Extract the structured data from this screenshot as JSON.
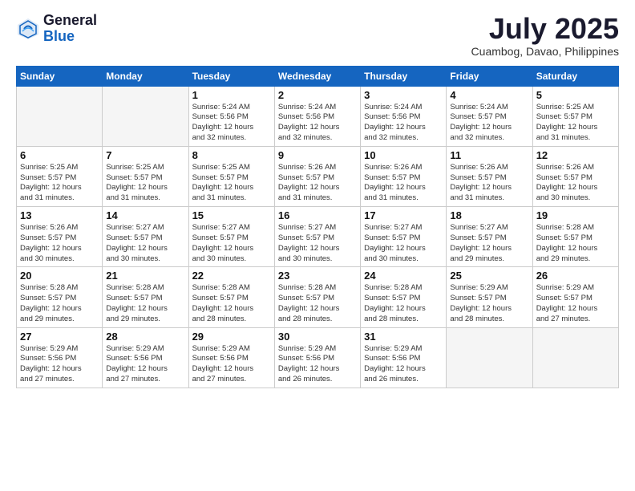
{
  "header": {
    "logo_general": "General",
    "logo_blue": "Blue",
    "month_year": "July 2025",
    "location": "Cuambog, Davao, Philippines"
  },
  "weekdays": [
    "Sunday",
    "Monday",
    "Tuesday",
    "Wednesday",
    "Thursday",
    "Friday",
    "Saturday"
  ],
  "weeks": [
    [
      {
        "day": "",
        "info": ""
      },
      {
        "day": "",
        "info": ""
      },
      {
        "day": "1",
        "info": "Sunrise: 5:24 AM\nSunset: 5:56 PM\nDaylight: 12 hours\nand 32 minutes."
      },
      {
        "day": "2",
        "info": "Sunrise: 5:24 AM\nSunset: 5:56 PM\nDaylight: 12 hours\nand 32 minutes."
      },
      {
        "day": "3",
        "info": "Sunrise: 5:24 AM\nSunset: 5:56 PM\nDaylight: 12 hours\nand 32 minutes."
      },
      {
        "day": "4",
        "info": "Sunrise: 5:24 AM\nSunset: 5:57 PM\nDaylight: 12 hours\nand 32 minutes."
      },
      {
        "day": "5",
        "info": "Sunrise: 5:25 AM\nSunset: 5:57 PM\nDaylight: 12 hours\nand 31 minutes."
      }
    ],
    [
      {
        "day": "6",
        "info": "Sunrise: 5:25 AM\nSunset: 5:57 PM\nDaylight: 12 hours\nand 31 minutes."
      },
      {
        "day": "7",
        "info": "Sunrise: 5:25 AM\nSunset: 5:57 PM\nDaylight: 12 hours\nand 31 minutes."
      },
      {
        "day": "8",
        "info": "Sunrise: 5:25 AM\nSunset: 5:57 PM\nDaylight: 12 hours\nand 31 minutes."
      },
      {
        "day": "9",
        "info": "Sunrise: 5:26 AM\nSunset: 5:57 PM\nDaylight: 12 hours\nand 31 minutes."
      },
      {
        "day": "10",
        "info": "Sunrise: 5:26 AM\nSunset: 5:57 PM\nDaylight: 12 hours\nand 31 minutes."
      },
      {
        "day": "11",
        "info": "Sunrise: 5:26 AM\nSunset: 5:57 PM\nDaylight: 12 hours\nand 31 minutes."
      },
      {
        "day": "12",
        "info": "Sunrise: 5:26 AM\nSunset: 5:57 PM\nDaylight: 12 hours\nand 30 minutes."
      }
    ],
    [
      {
        "day": "13",
        "info": "Sunrise: 5:26 AM\nSunset: 5:57 PM\nDaylight: 12 hours\nand 30 minutes."
      },
      {
        "day": "14",
        "info": "Sunrise: 5:27 AM\nSunset: 5:57 PM\nDaylight: 12 hours\nand 30 minutes."
      },
      {
        "day": "15",
        "info": "Sunrise: 5:27 AM\nSunset: 5:57 PM\nDaylight: 12 hours\nand 30 minutes."
      },
      {
        "day": "16",
        "info": "Sunrise: 5:27 AM\nSunset: 5:57 PM\nDaylight: 12 hours\nand 30 minutes."
      },
      {
        "day": "17",
        "info": "Sunrise: 5:27 AM\nSunset: 5:57 PM\nDaylight: 12 hours\nand 30 minutes."
      },
      {
        "day": "18",
        "info": "Sunrise: 5:27 AM\nSunset: 5:57 PM\nDaylight: 12 hours\nand 29 minutes."
      },
      {
        "day": "19",
        "info": "Sunrise: 5:28 AM\nSunset: 5:57 PM\nDaylight: 12 hours\nand 29 minutes."
      }
    ],
    [
      {
        "day": "20",
        "info": "Sunrise: 5:28 AM\nSunset: 5:57 PM\nDaylight: 12 hours\nand 29 minutes."
      },
      {
        "day": "21",
        "info": "Sunrise: 5:28 AM\nSunset: 5:57 PM\nDaylight: 12 hours\nand 29 minutes."
      },
      {
        "day": "22",
        "info": "Sunrise: 5:28 AM\nSunset: 5:57 PM\nDaylight: 12 hours\nand 28 minutes."
      },
      {
        "day": "23",
        "info": "Sunrise: 5:28 AM\nSunset: 5:57 PM\nDaylight: 12 hours\nand 28 minutes."
      },
      {
        "day": "24",
        "info": "Sunrise: 5:28 AM\nSunset: 5:57 PM\nDaylight: 12 hours\nand 28 minutes."
      },
      {
        "day": "25",
        "info": "Sunrise: 5:29 AM\nSunset: 5:57 PM\nDaylight: 12 hours\nand 28 minutes."
      },
      {
        "day": "26",
        "info": "Sunrise: 5:29 AM\nSunset: 5:57 PM\nDaylight: 12 hours\nand 27 minutes."
      }
    ],
    [
      {
        "day": "27",
        "info": "Sunrise: 5:29 AM\nSunset: 5:56 PM\nDaylight: 12 hours\nand 27 minutes."
      },
      {
        "day": "28",
        "info": "Sunrise: 5:29 AM\nSunset: 5:56 PM\nDaylight: 12 hours\nand 27 minutes."
      },
      {
        "day": "29",
        "info": "Sunrise: 5:29 AM\nSunset: 5:56 PM\nDaylight: 12 hours\nand 27 minutes."
      },
      {
        "day": "30",
        "info": "Sunrise: 5:29 AM\nSunset: 5:56 PM\nDaylight: 12 hours\nand 26 minutes."
      },
      {
        "day": "31",
        "info": "Sunrise: 5:29 AM\nSunset: 5:56 PM\nDaylight: 12 hours\nand 26 minutes."
      },
      {
        "day": "",
        "info": ""
      },
      {
        "day": "",
        "info": ""
      }
    ]
  ]
}
